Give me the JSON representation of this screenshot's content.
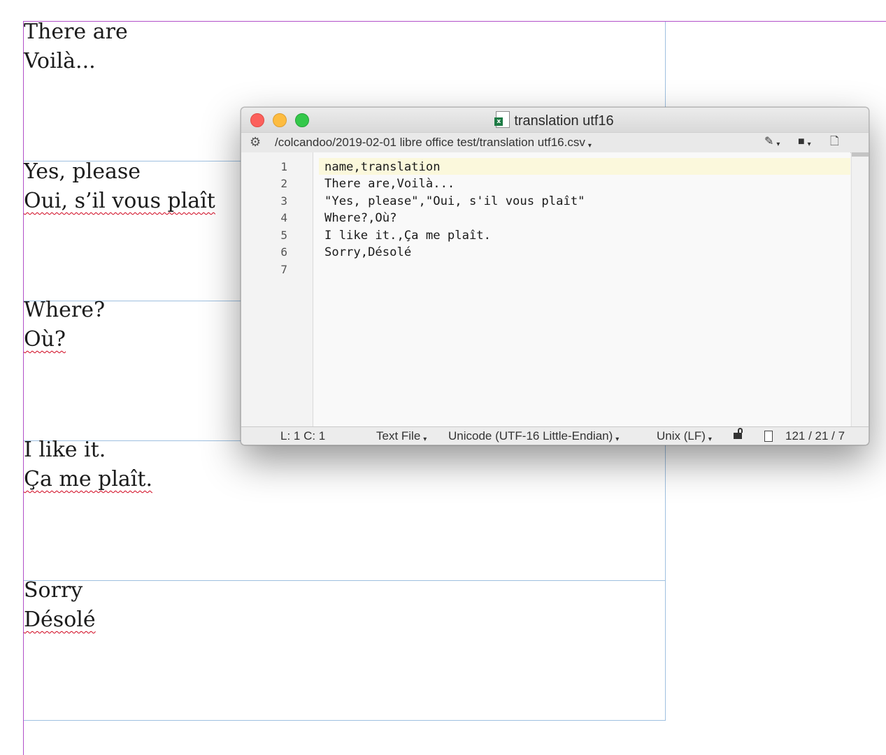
{
  "page": {
    "records": [
      {
        "name": "There are",
        "translation": "Voilà...",
        "name_spell": false,
        "translation_spell": false
      },
      {
        "name": "Yes, please",
        "translation": "Oui, s’il vous plaît",
        "name_spell": false,
        "translation_spell": true
      },
      {
        "name": "Where?",
        "translation": "Où?",
        "name_spell": false,
        "translation_spell": true
      },
      {
        "name": "I like it.",
        "translation": "Ça me plaît.",
        "name_spell": false,
        "translation_spell": true
      },
      {
        "name": "Sorry",
        "translation": "Désolé",
        "name_spell": false,
        "translation_spell": true
      }
    ]
  },
  "editor": {
    "title": "translation utf16",
    "file_icon": "excel-document-icon",
    "path": "/colcandoo/2019-02-01 libre office test/translation utf16.csv",
    "toolbar_icons": [
      "gear-icon",
      "pen-icon",
      "document-menu-icon",
      "new-document-icon"
    ],
    "lines": [
      "name,translation",
      "There are,Voilà...",
      "\"Yes, please\",\"Oui, s'il vous plaît\"",
      "Where?,Où?",
      "I like it.,Ça me plaît.",
      "Sorry,Désolé",
      ""
    ],
    "line_numbers": [
      "1",
      "2",
      "3",
      "4",
      "5",
      "6",
      "7"
    ],
    "status": {
      "cursor": "L: 1 C: 1",
      "syntax": "Text File",
      "encoding": "Unicode (UTF-16 Little-Endian)",
      "line_endings": "Unix (LF)",
      "counts": "121 / 21 / 7"
    },
    "colors": {
      "close": "#fc605c",
      "minimize": "#fdbc40",
      "zoom": "#34c84a",
      "current_line": "#fbf8dc"
    }
  }
}
